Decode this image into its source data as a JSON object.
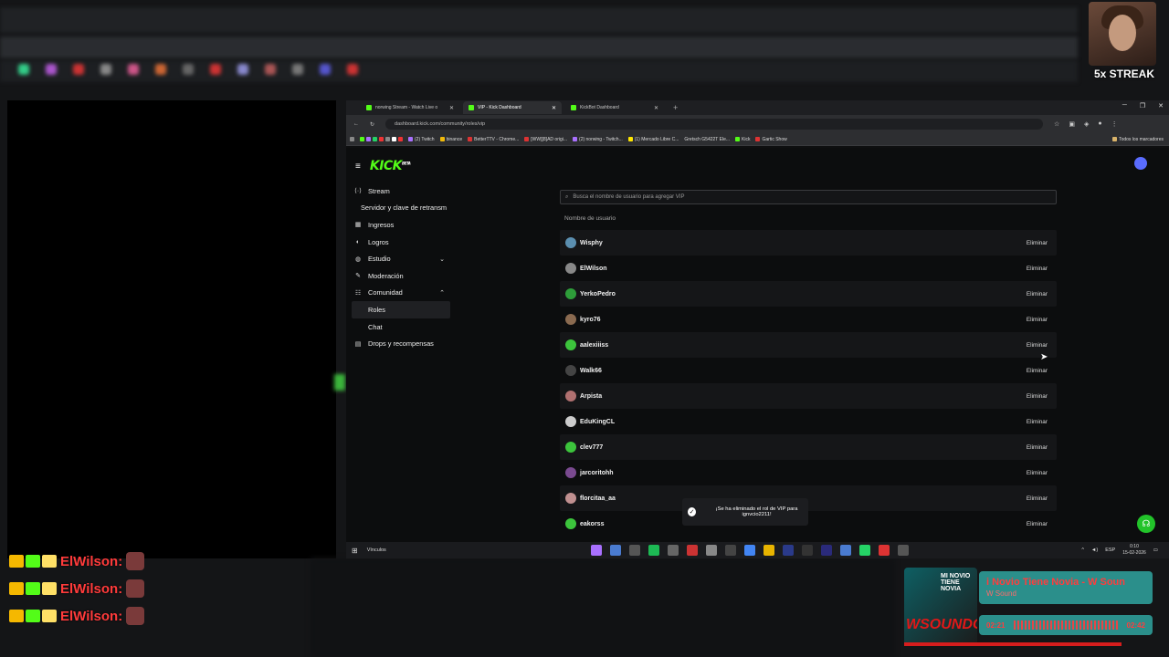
{
  "streak": {
    "label": "5x STREAK"
  },
  "browser": {
    "tabs": [
      {
        "label": "norwing Stream - Watch Live o",
        "active": false
      },
      {
        "label": "VIP - Kick Dashboard",
        "active": true
      },
      {
        "label": "KickBot Dashboard",
        "active": false
      }
    ],
    "url": "dashboard.kick.com/community/roles/vip",
    "bookmarks": [
      "(2) Twitch",
      "binance",
      "BetterTTV - Chrome...",
      "[WW][8]AD origi...",
      "(2) norwing - Twitch...",
      "(1) Mercado Libre C...",
      "Gretsch G5422T Ele...",
      "Kick",
      "Gartic Show"
    ],
    "bookmarks_all": "Todos los marcadores"
  },
  "sidebar": {
    "items": [
      {
        "label": "Stream",
        "icon": "stream-icon",
        "style": "icon"
      },
      {
        "label": "Servidor y clave de retransm",
        "icon": "",
        "style": "plain"
      },
      {
        "label": "Ingresos",
        "icon": "dollar-icon",
        "style": "icon"
      },
      {
        "label": "Logros",
        "icon": "trophy-icon",
        "style": "icon"
      },
      {
        "label": "Estudio",
        "icon": "studio-icon",
        "style": "icon",
        "chevron": "down"
      },
      {
        "label": "Moderación",
        "icon": "moderation-icon",
        "style": "icon"
      },
      {
        "label": "Comunidad",
        "icon": "community-icon",
        "style": "icon",
        "chevron": "up"
      },
      {
        "label": "Roles",
        "icon": "",
        "style": "sub",
        "active": true
      },
      {
        "label": "Chat",
        "icon": "",
        "style": "sub"
      },
      {
        "label": "Drops y recompensas",
        "icon": "gift-icon",
        "style": "icon"
      }
    ]
  },
  "main": {
    "search_placeholder": "Busca el nombre de usuario para agregar VIP",
    "column_header": "Nombre de usuario",
    "remove_label": "Eliminar",
    "users": [
      {
        "name": "Wisphy",
        "color": "#5b8fb0"
      },
      {
        "name": "ElWilson",
        "color": "#888888"
      },
      {
        "name": "YerkoPedro",
        "color": "#2e9e3a"
      },
      {
        "name": "kyro76",
        "color": "#8a6a50"
      },
      {
        "name": "aalexiiiss",
        "color": "#3cc43c"
      },
      {
        "name": "Walk66",
        "color": "#444444"
      },
      {
        "name": "Arpista",
        "color": "#b07070"
      },
      {
        "name": "EduKingCL",
        "color": "#cccccc"
      },
      {
        "name": "clev777",
        "color": "#3cc43c"
      },
      {
        "name": "jarcoritohh",
        "color": "#7a4a90"
      },
      {
        "name": "florcitaa_aa",
        "color": "#c09090"
      },
      {
        "name": "eakorss",
        "color": "#3cc43c"
      }
    ]
  },
  "toast": {
    "message": "¡Se ha eliminado el rol de VIP para ignvcio2211!"
  },
  "taskbar": {
    "label": "Vínculos",
    "lang": "ESP",
    "time": "0:10",
    "date": "15-02-2026"
  },
  "chat": [
    {
      "user": "ElWilson:"
    },
    {
      "user": "ElWilson:"
    },
    {
      "user": "ElWilson:"
    }
  ],
  "music": {
    "art_top": "MI NOVIO TIENE NOVIA",
    "art_logo": "WSOUNDO3",
    "song": "i Novio Tiene Novia - W Soun",
    "artist": "W Sound",
    "elapsed": "02:21",
    "total": "02:42",
    "progress": 0.87
  },
  "colors": {
    "accent": "#53fc18",
    "background": "#0c0d0e"
  }
}
